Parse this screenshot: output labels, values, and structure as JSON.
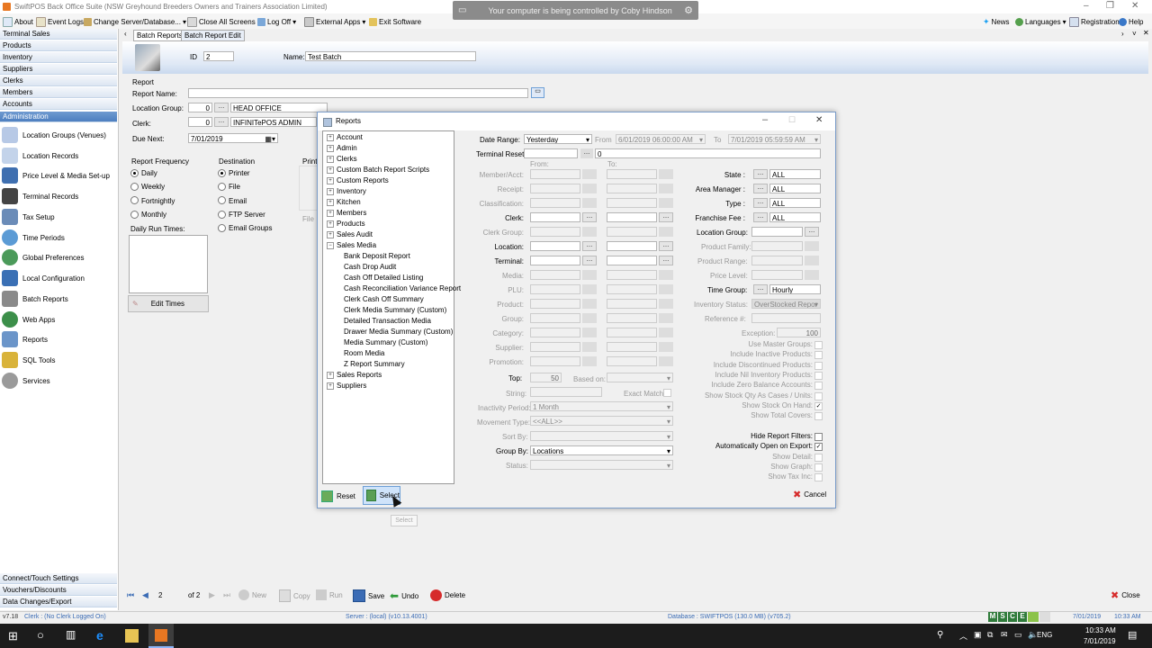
{
  "window": {
    "title": "SwiftPOS Back Office Suite (NSW Greyhound Breeders Owners and Trainers Association Limited)"
  },
  "banner": {
    "text": "Your computer is being controlled by Coby Hindson"
  },
  "menu": {
    "about": "About",
    "event_logs": "Event Logs",
    "change_server": "Change Server/Database...",
    "close_all": "Close All Screens",
    "log_off": "Log Off",
    "external_apps": "External Apps",
    "exit": "Exit Software",
    "news": "News",
    "languages": "Languages",
    "registration": "Registration",
    "help": "Help"
  },
  "nav": {
    "sections_top": [
      "Terminal Sales",
      "Products",
      "Inventory",
      "Suppliers",
      "Clerks",
      "Members",
      "Accounts",
      "Administration"
    ],
    "items": [
      "Location Groups (Venues)",
      "Location Records",
      "Price Level & Media Set-up",
      "Terminal Records",
      "Tax Setup",
      "Time Periods",
      "Global Preferences",
      "Local Configuration",
      "Batch Reports",
      "Web Apps",
      "Reports",
      "SQL Tools",
      "Services"
    ],
    "sections_bottom": [
      "Connect/Touch Settings",
      "Vouchers/Discounts",
      "Data Changes/Export"
    ]
  },
  "tabs": [
    "Batch Reports",
    "Batch Report Edit"
  ],
  "form": {
    "id_label": "ID",
    "id_value": "2",
    "name_label": "Name:",
    "name_value": "Test Batch",
    "report_group": "Report",
    "report_name_label": "Report Name:",
    "location_group_label": "Location Group:",
    "location_group_num": "0",
    "location_group_value": "HEAD OFFICE",
    "clerk_label": "Clerk:",
    "clerk_num": "0",
    "clerk_value": "INFINITePOS ADMIN",
    "due_next_label": "Due Next:",
    "due_next_value": "7/01/2019",
    "frequency_label": "Report Frequency",
    "frequencies": [
      "Daily",
      "Weekly",
      "Fortnightly",
      "Monthly"
    ],
    "daily_run_times_label": "Daily Run Times:",
    "edit_times": "Edit Times",
    "destination_label": "Destination",
    "destinations": [
      "Printer",
      "File",
      "Email",
      "FTP Server",
      "Email Groups"
    ],
    "printer_label": "Printe",
    "file_label": "File"
  },
  "dialog": {
    "title": "Reports",
    "tree": [
      "Account",
      "Admin",
      "Clerks",
      "Custom Batch Report Scripts",
      "Custom Reports",
      "Inventory",
      "Kitchen",
      "Members",
      "Products",
      "Sales Audit",
      "Sales Media"
    ],
    "tree_children": [
      "Bank Deposit Report",
      "Cash Drop Audit",
      "Cash Off Detailed Listing",
      "Cash Reconciliation Variance Report",
      "Clerk Cash Off Summary",
      "Clerk Media Summary (Custom)",
      "Detailed Transaction Media",
      "Drawer Media Summary (Custom)",
      "Media Summary (Custom)",
      "Room Media",
      "Z Report Summary"
    ],
    "tree_after": [
      "Sales Reports",
      "Suppliers"
    ],
    "date_range_label": "Date Range:",
    "date_range_value": "Yesterday",
    "from_label": "From",
    "from_value": "6/01/2019 06:00:00 AM",
    "to_label": "To",
    "to_value": "7/01/2019 05:59:59 AM",
    "terminal_reset_label": "Terminal Reset",
    "terminal_reset_value": "0",
    "from_col": "From:",
    "to_col": "To:",
    "filters_left": [
      "Member/Acct:",
      "Receipt:",
      "Classification:",
      "Clerk:",
      "Clerk Group:",
      "Location:",
      "Terminal:",
      "Media:",
      "PLU:",
      "Product:",
      "Group:",
      "Category:",
      "Supplier:",
      "Promotion:"
    ],
    "top_label": "Top:",
    "top_value": "50",
    "based_on_label": "Based on:",
    "string_label": "String:",
    "exact_match_label": "Exact Match:",
    "inactivity_label": "Inactivity Period:",
    "inactivity_value": "1 Month",
    "movement_label": "Movement Type:",
    "movement_value": "<<ALL>>",
    "sort_by_label": "Sort By:",
    "group_by_label": "Group By:",
    "group_by_value": "Locations",
    "status_label": "Status:",
    "right_filters": [
      {
        "label": "State :",
        "value": "ALL"
      },
      {
        "label": "Area Manager :",
        "value": "ALL"
      },
      {
        "label": "Type :",
        "value": "ALL"
      },
      {
        "label": "Franchise Fee :",
        "value": "ALL"
      }
    ],
    "location_group_label": "Location Group:",
    "product_family_label": "Product Family:",
    "product_range_label": "Product Range:",
    "price_level_label": "Price Level:",
    "time_group_label": "Time Group:",
    "time_group_value": "Hourly",
    "inventory_status_label": "Inventory Status:",
    "inventory_status_value": "OverStocked Repor",
    "reference_label": "Reference #:",
    "exception_label": "Exception:",
    "exception_value": "100",
    "options": [
      "Use Master Groups:",
      "Include Inactive Products:",
      "Include Discontinued Products:",
      "Include Nil Inventory Products:",
      "Include Zero Balance Accounts:",
      "Show Stock Qty As Cases / Units:",
      "Show Stock On Hand:",
      "Show Total Covers:"
    ],
    "options2": [
      "Hide Report Filters:",
      "Automatically Open on Export:",
      "Show Detail:",
      "Show Graph:",
      "Show Tax Inc:"
    ],
    "reset": "Reset",
    "select": "Select",
    "cancel": "Cancel",
    "tooltip": "Select"
  },
  "toolbar": {
    "record": "2",
    "of": "of 2",
    "new": "New",
    "copy": "Copy",
    "run": "Run",
    "save": "Save",
    "undo": "Undo",
    "delete": "Delete",
    "close": "Close"
  },
  "status": {
    "version": "v7.18",
    "clerk": "Clerk : (No Clerk Logged On)",
    "server": "Server : (local) (v10.13.4001)",
    "database": "Database : SWIFTPOS (130.0 MB) (v705.2)",
    "date": "7/01/2019",
    "time": "10:33 AM",
    "badges": [
      "M",
      "S",
      "C",
      "E"
    ]
  },
  "taskbar": {
    "lang": "ENG",
    "time": "10:33 AM",
    "date": "7/01/2019"
  },
  "colors": {
    "accent": "#4d7fc0",
    "taskbar": "#1c1c1c",
    "delete_red": "#d62b2b",
    "green": "#2f9a3a"
  }
}
